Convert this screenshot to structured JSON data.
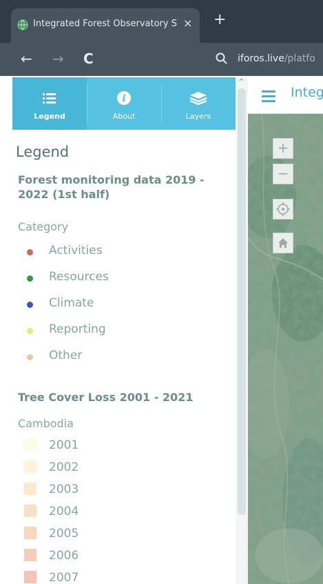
{
  "browser": {
    "tab_title": "Integrated Forest Observatory S",
    "tab_close": "×",
    "new_tab": "+",
    "back": "←",
    "forward": "→",
    "reload": "C",
    "url_host": "iforos.live",
    "url_path": "/platfo"
  },
  "sidebar": {
    "tabs": [
      {
        "label": "Legend",
        "active": true
      },
      {
        "label": "About",
        "active": false
      },
      {
        "label": "Layers",
        "active": false
      }
    ],
    "about_glyph": "i",
    "scroll_up": "^"
  },
  "legend": {
    "heading": "Legend",
    "layer1_title": "Forest monitoring data 2019 - 2022 (1st half)",
    "layer1_subtitle": "Category",
    "categories": [
      {
        "label": "Activities",
        "color": "#d2694a"
      },
      {
        "label": "Resources",
        "color": "#2e9a3c"
      },
      {
        "label": "Climate",
        "color": "#3b4fe0"
      },
      {
        "label": "Reporting",
        "color": "#e2ee6a"
      },
      {
        "label": "Other",
        "color": "#ecc9a6"
      }
    ],
    "layer2_title": "Tree Cover Loss 2001 - 2021",
    "layer2_subtitle": "Cambodia",
    "years": [
      {
        "label": "2001",
        "color": "#fdfbe4"
      },
      {
        "label": "2002",
        "color": "#fcf3d8"
      },
      {
        "label": "2003",
        "color": "#fbead0"
      },
      {
        "label": "2004",
        "color": "#f9e0c6"
      },
      {
        "label": "2005",
        "color": "#f8d7c1"
      },
      {
        "label": "2006",
        "color": "#f7cdb8"
      },
      {
        "label": "2007",
        "color": "#f5c4b4"
      }
    ]
  },
  "app": {
    "title": "Integrated Forest Observatory"
  },
  "map_controls": {
    "zoom_in": "+",
    "zoom_out": "−"
  }
}
